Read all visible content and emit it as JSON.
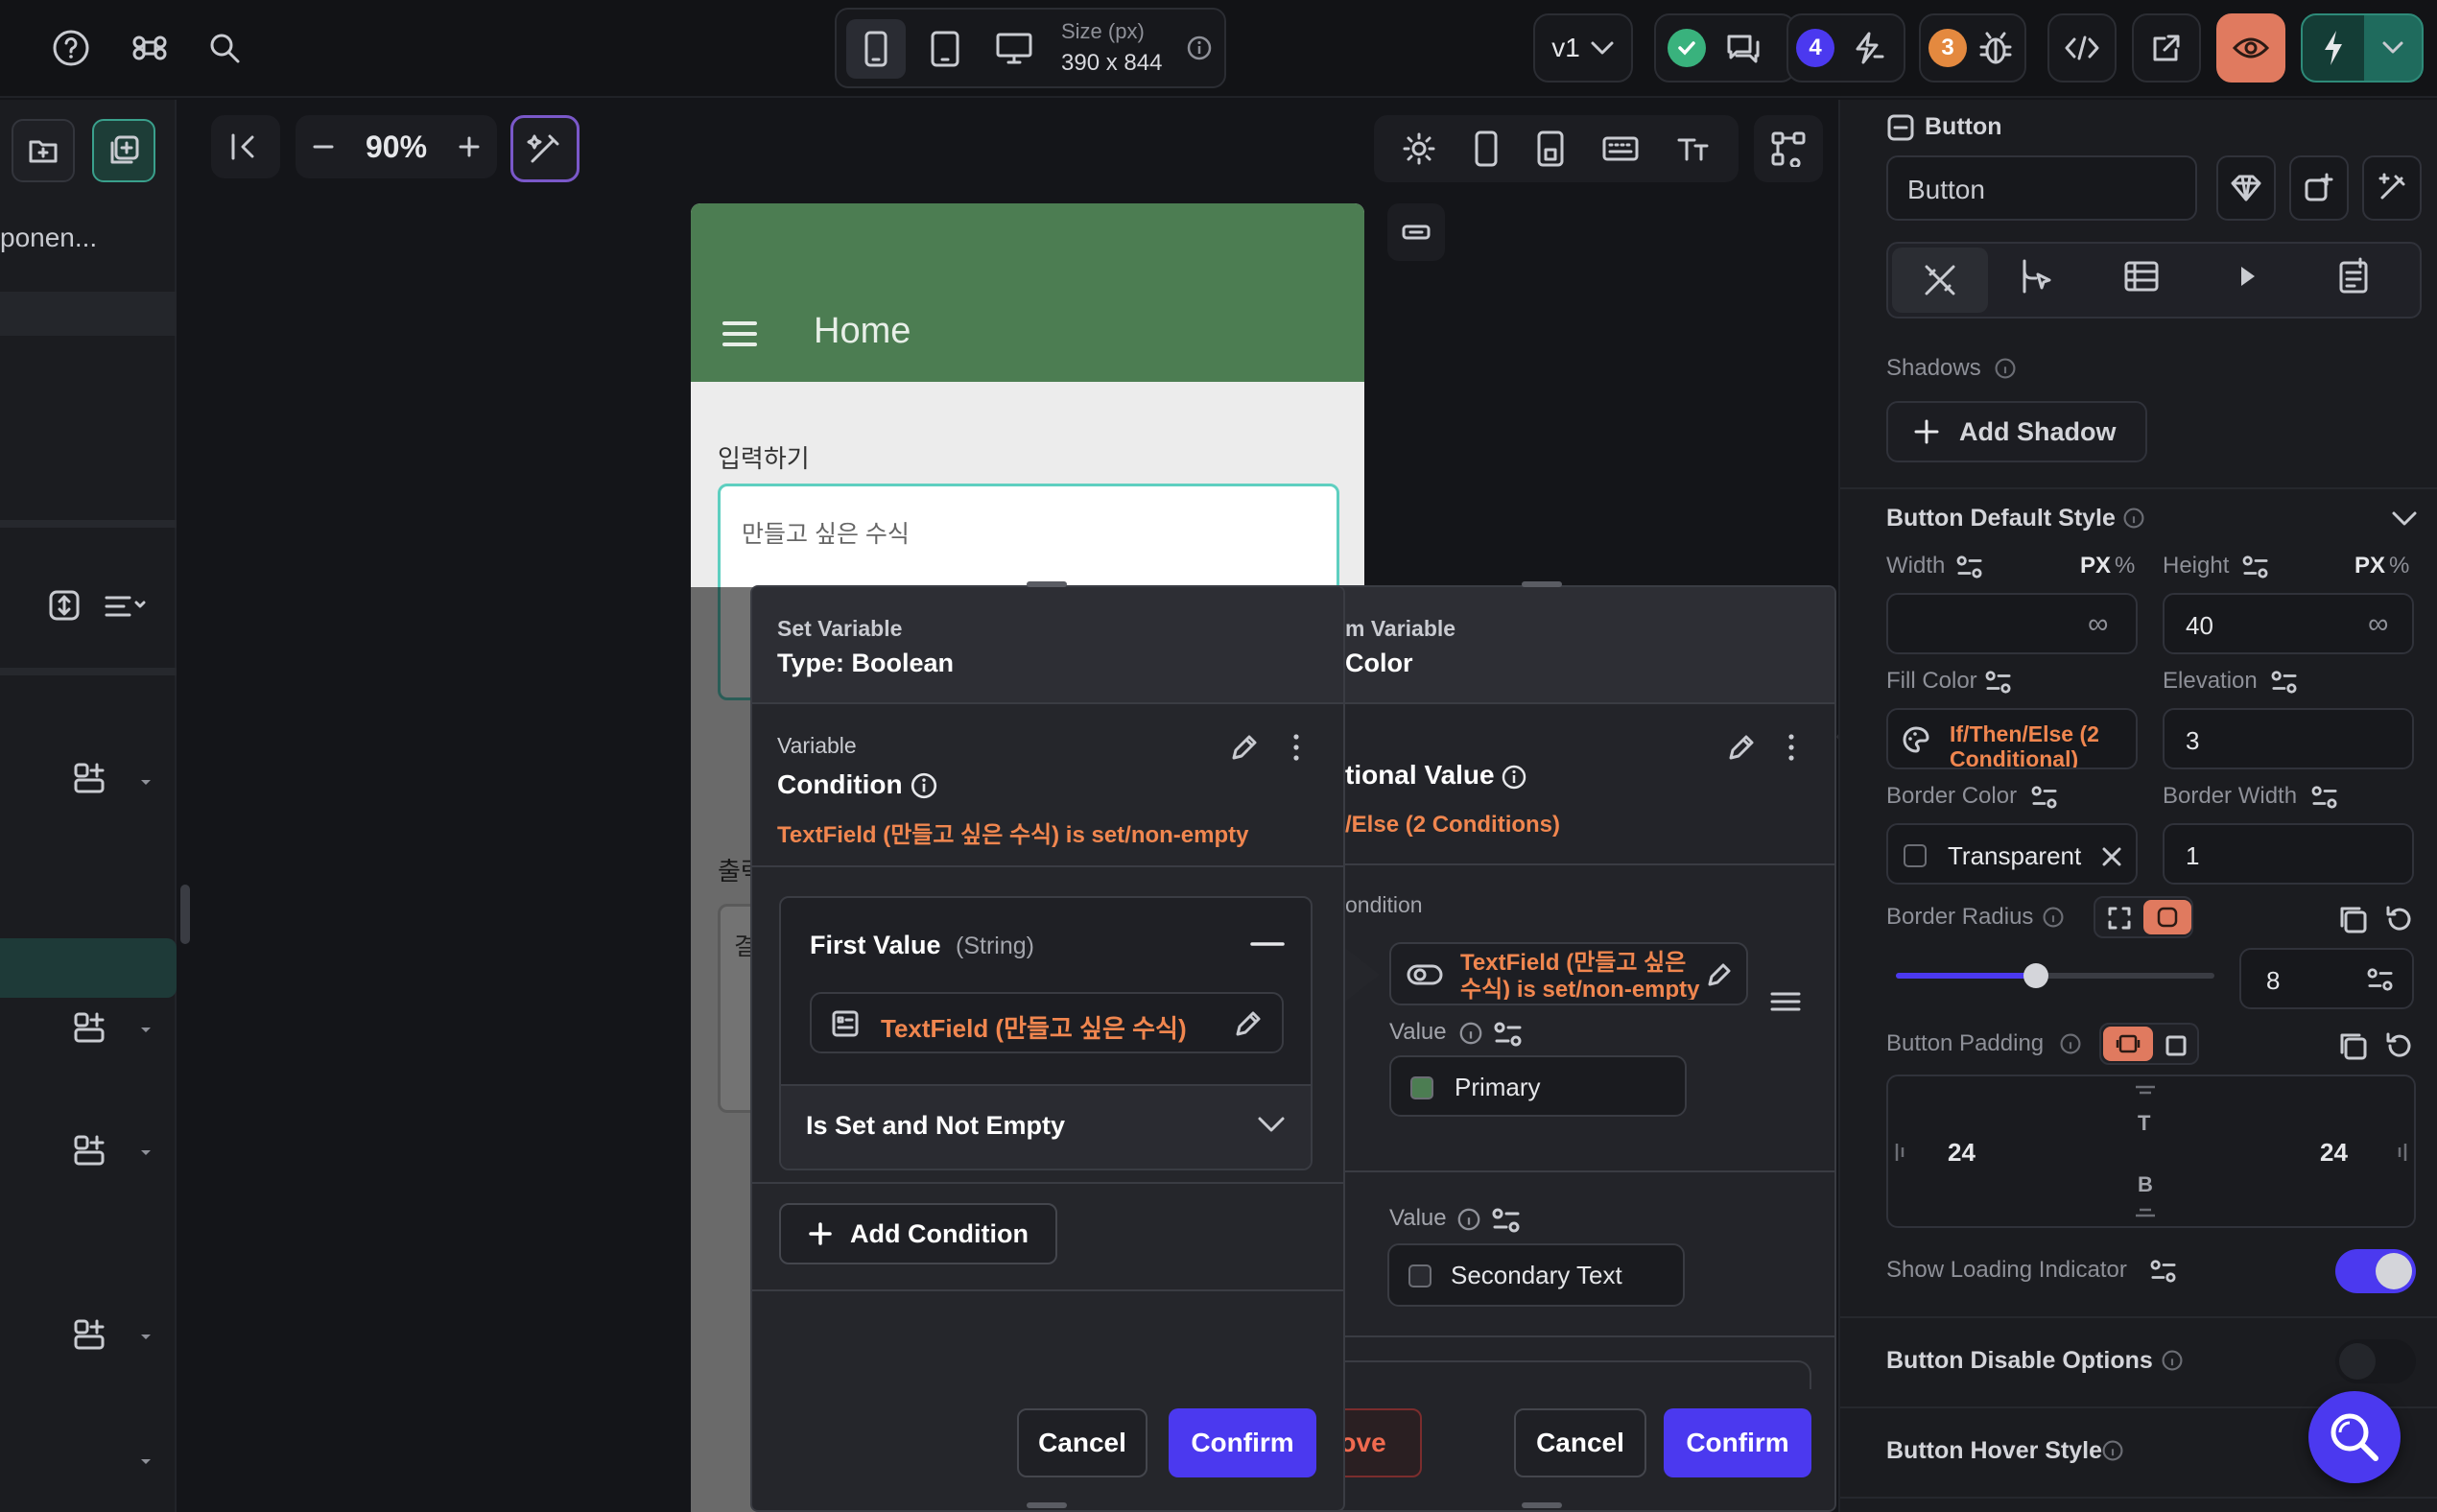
{
  "topbar": {
    "help_icon": "help-circle-icon",
    "command_icon": "command-icon",
    "search_icon": "search-icon",
    "size_label": "Size (px)",
    "size_value": "390 x 844",
    "version": "v1",
    "badge_agents": "4",
    "badge_issues": "3"
  },
  "left": {
    "partial_text": "ponen..."
  },
  "canvas": {
    "zoom": "90%"
  },
  "phone": {
    "title": "Home",
    "input_label": "입력하기",
    "input_placeholder": "만들고 싶은 수식",
    "output_label": "출력",
    "output_partial": "결"
  },
  "dialog_front": {
    "header_sub": "Set Variable",
    "header_title": "Type: Boolean",
    "variable_label": "Variable",
    "variable_name": "Condition",
    "variable_desc": "TextField (만들고 싶은 수식) is set/non-empty",
    "first_value_label": "First Value",
    "first_value_type": "(String)",
    "first_value_source": "TextField (만들고 싶은 수식)",
    "operator": "Is Set and Not Empty",
    "add_condition": "Add Condition",
    "cancel": "Cancel",
    "confirm": "Confirm"
  },
  "dialog_back": {
    "header_sub": "m Variable",
    "header_title": "Color",
    "value_name": "tional Value",
    "value_desc": "/Else (2 Conditions)",
    "condition_label": "ondition",
    "condition_chip": "TextField (만들고 싶은 수식) is set/non-empty",
    "value_label_1": "Value",
    "value_1": "Primary",
    "value_label_2": "Value",
    "value_2": "Secondary Text",
    "remove": "nove",
    "cancel": "Cancel",
    "confirm": "Confirm"
  },
  "right_panel": {
    "widget_type": "Button",
    "widget_name": "Button",
    "shadows_label": "Shadows",
    "add_shadow": "Add Shadow",
    "default_style_title": "Button Default Style",
    "width_label": "Width",
    "height_label": "Height",
    "unit_px": "PX",
    "unit_pct": "%",
    "height_value": "40",
    "infinity": "∞",
    "fill_color_label": "Fill Color",
    "fill_color_value": "If/Then/Else (2 Conditional)",
    "elevation_label": "Elevation",
    "elevation_value": "3",
    "border_color_label": "Border Color",
    "border_color_value": "Transparent",
    "border_width_label": "Border Width",
    "border_width_value": "1",
    "border_radius_label": "Border Radius",
    "border_radius_value": "8",
    "border_radius_slider": 0.44,
    "padding_label": "Button Padding",
    "padding_left": "24",
    "padding_right": "24",
    "padding_top": "T",
    "padding_bottom": "B",
    "loading_label": "Show Loading Indicator",
    "loading_on": true,
    "disable_options": "Button Disable Options",
    "hover_style": "Button Hover Style"
  },
  "colors": {
    "accent": "#4b39ef",
    "orange": "#f0864f",
    "appbar_green": "#4c7d52",
    "success": "#39b27d"
  }
}
